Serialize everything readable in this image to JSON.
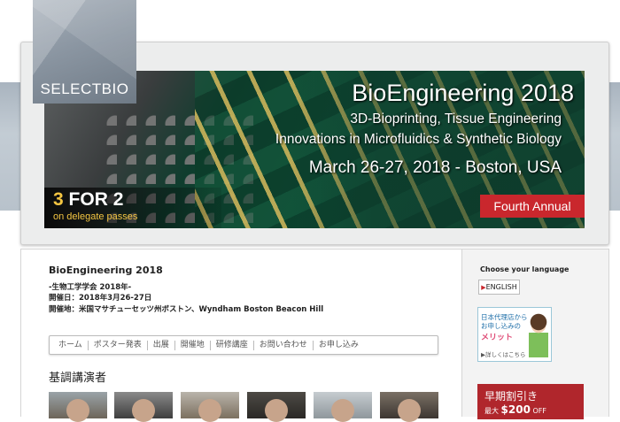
{
  "logo": {
    "text": "SELECTBIO"
  },
  "banner": {
    "title": "BioEngineering 2018",
    "subtitle_1": "3D-Bioprinting, Tissue Engineering",
    "subtitle_2": "Innovations in Microfluidics & Synthetic Biology",
    "date_location": "March 26-27, 2018 - Boston, USA",
    "promo_number": "3",
    "promo_rest": "FOR 2",
    "promo_sub": "on delegate passes",
    "edition": "Fourth Annual"
  },
  "event": {
    "title": "BioEngineering 2018",
    "jp_name": "-生物工学学会 2018年-",
    "dates": "開催日：2018年3月26-27日",
    "venue": "開催地：米国マサチューセッツ州ボストン、Wyndham Boston Beacon Hill"
  },
  "nav": {
    "items": [
      "ホーム",
      "ポスター発表",
      "出展",
      "開催地",
      "研修講座",
      "お問い合わせ",
      "お申し込み"
    ]
  },
  "keynote": {
    "heading": "基調講演者"
  },
  "sidebar": {
    "lang_label": "Choose your language",
    "lang_button": "ENGLISH",
    "agent_line1": "日本代理店から",
    "agent_line2": "お申し込みの",
    "agent_line3": "メリット",
    "agent_link": "▶詳しくはこちら",
    "early_title": "早期割引き",
    "early_prefix": "最大",
    "early_amount": "$200",
    "early_suffix": "OFF"
  }
}
